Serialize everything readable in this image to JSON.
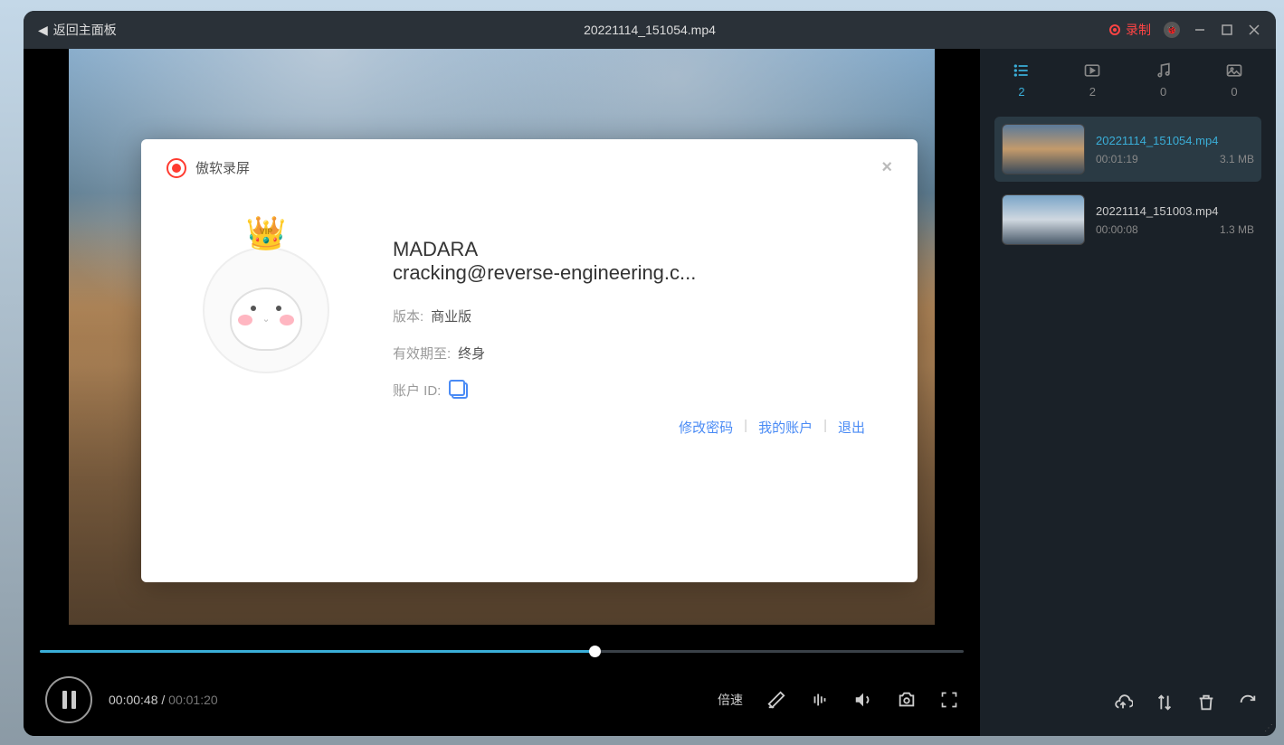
{
  "titlebar": {
    "back": "返回主面板",
    "title": "20221114_151054.mp4",
    "record": "录制"
  },
  "modal": {
    "app_name": "傲软录屏",
    "vip_badge": "VIP",
    "user_name": "MADARA",
    "user_email": "cracking@reverse-engineering.c...",
    "version_label": "版本:",
    "version_value": "商业版",
    "expiry_label": "有效期至:",
    "expiry_value": "终身",
    "account_id_label": "账户 ID:",
    "change_password": "修改密码",
    "my_account": "我的账户",
    "logout": "退出"
  },
  "player": {
    "current_time": "00:00:48",
    "total_time": "00:01:20",
    "progress_percent": 60,
    "speed_label": "倍速"
  },
  "filters": [
    {
      "icon": "list",
      "count": "2",
      "active": true
    },
    {
      "icon": "video",
      "count": "2",
      "active": false
    },
    {
      "icon": "audio",
      "count": "0",
      "active": false
    },
    {
      "icon": "image",
      "count": "0",
      "active": false
    }
  ],
  "files": [
    {
      "name": "20221114_151054.mp4",
      "duration": "00:01:19",
      "size": "3.1 MB",
      "selected": true
    },
    {
      "name": "20221114_151003.mp4",
      "duration": "00:00:08",
      "size": "1.3 MB",
      "selected": false
    }
  ]
}
